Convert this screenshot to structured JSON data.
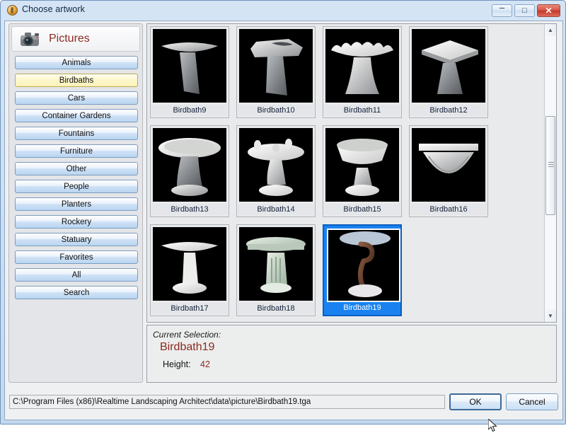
{
  "window": {
    "title": "Choose artwork",
    "icon": "app-circle-icon",
    "controls": {
      "minimize": "–",
      "maximize": "□",
      "close": "✕"
    }
  },
  "sidebar": {
    "header": {
      "icon": "camera-icon",
      "title": "Pictures"
    },
    "items": [
      {
        "label": "Animals",
        "selected": false
      },
      {
        "label": "Birdbaths",
        "selected": true
      },
      {
        "label": "Cars",
        "selected": false
      },
      {
        "label": "Container Gardens",
        "selected": false
      },
      {
        "label": "Fountains",
        "selected": false
      },
      {
        "label": "Furniture",
        "selected": false
      },
      {
        "label": "Other",
        "selected": false
      },
      {
        "label": "People",
        "selected": false
      },
      {
        "label": "Planters",
        "selected": false
      },
      {
        "label": "Rockery",
        "selected": false
      },
      {
        "label": "Statuary",
        "selected": false
      },
      {
        "label": "Favorites",
        "selected": false
      },
      {
        "label": "All",
        "selected": false
      },
      {
        "label": "Search",
        "selected": false
      }
    ]
  },
  "grid": {
    "columns": 4,
    "items": [
      {
        "label": "Birdbath9",
        "kind": "flat-bowl-slab-pedestal",
        "selected": false
      },
      {
        "label": "Birdbath10",
        "kind": "rough-rock-slab",
        "selected": false
      },
      {
        "label": "Birdbath11",
        "kind": "scalloped-flower-bowl",
        "selected": false
      },
      {
        "label": "Birdbath12",
        "kind": "square-tray-pedestal",
        "selected": false
      },
      {
        "label": "Birdbath13",
        "kind": "round-bowl-twisted-column",
        "selected": false
      },
      {
        "label": "Birdbath14",
        "kind": "bowl-with-birds",
        "selected": false
      },
      {
        "label": "Birdbath15",
        "kind": "deep-urn-bowl",
        "selected": false
      },
      {
        "label": "Birdbath16",
        "kind": "carved-urn-planter",
        "selected": false
      },
      {
        "label": "Birdbath17",
        "kind": "white-smooth-pedestal",
        "selected": false
      },
      {
        "label": "Birdbath18",
        "kind": "green-fluted-pedestal",
        "selected": false
      },
      {
        "label": "Birdbath19",
        "kind": "bronze-swan-stand",
        "selected": true
      }
    ],
    "scrollbar": {
      "up_icon": "▲",
      "down_icon": "▼"
    }
  },
  "selection": {
    "label": "Current Selection:",
    "name": "Birdbath19",
    "height_label": "Height:",
    "height_value": "42"
  },
  "footer": {
    "path": "C:\\Program Files (x86)\\Realtime Landscaping Architect\\data\\picture\\Birdbath19.tga",
    "ok_label": "OK",
    "cancel_label": "Cancel"
  },
  "colors": {
    "selection_blue": "#1a82f0",
    "accent_red": "#8b2a20",
    "highlight_yellow": "#fdf6c9",
    "close_red": "#c3392c"
  }
}
